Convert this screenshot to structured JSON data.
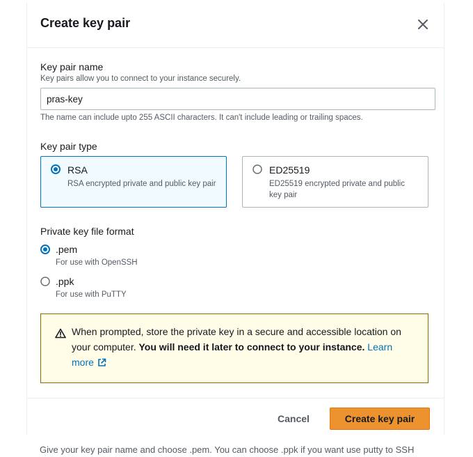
{
  "modal": {
    "title": "Create key pair",
    "close_icon": "close-icon"
  },
  "name_field": {
    "label": "Key pair name",
    "description": "Key pairs allow you to connect to your instance securely.",
    "value": "pras-key",
    "constraint": "The name can include upto 255 ASCII characters. It can't include leading or trailing spaces."
  },
  "key_type": {
    "label": "Key pair type",
    "options": [
      {
        "title": "RSA",
        "description": "RSA encrypted private and public key pair",
        "selected": true
      },
      {
        "title": "ED25519",
        "description": "ED25519 encrypted private and public key pair",
        "selected": false
      }
    ]
  },
  "file_format": {
    "label": "Private key file format",
    "options": [
      {
        "title": ".pem",
        "description": "For use with OpenSSH",
        "selected": true
      },
      {
        "title": ".ppk",
        "description": "For use with PuTTY",
        "selected": false
      }
    ]
  },
  "alert": {
    "icon": "warning-icon",
    "text_normal": "When prompted, store the private key in a secure and accessible location on your computer. ",
    "text_bold": "You will need it later to connect to your instance.",
    "link_label": "Learn more",
    "link_icon": "external-link-icon"
  },
  "footer": {
    "cancel_label": "Cancel",
    "create_label": "Create key pair"
  },
  "caption": "Give your key pair name and choose .pem. You can choose .ppk if you want use putty to SSH",
  "colors": {
    "accent": "#0073bb",
    "primary_button": "#ec9330",
    "warning_border": "#8d6605",
    "warning_bg": "#fffce8"
  }
}
